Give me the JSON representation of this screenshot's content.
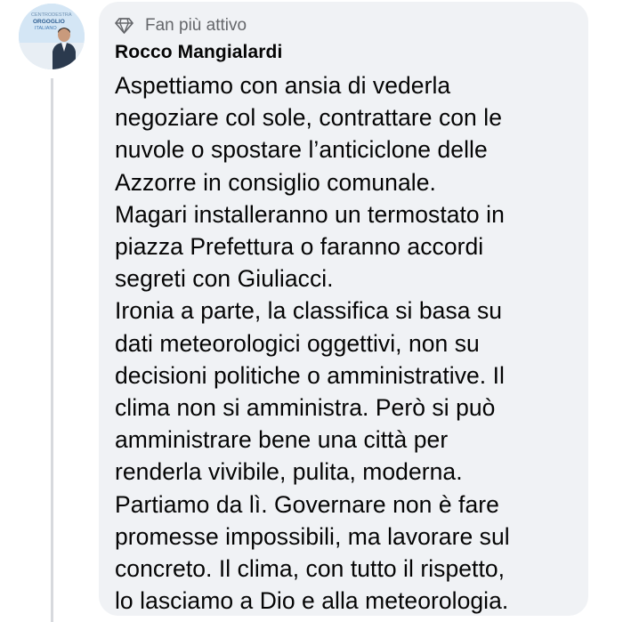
{
  "comment": {
    "badge_icon": "diamond-icon",
    "badge_label": "Fan più attivo",
    "author_name": "Rocco Mangialardi",
    "avatar_logo_text": [
      "CENTRODESTRA",
      "ORGOGLIO",
      "ITALIANO"
    ],
    "text": "Aspettiamo con ansia di vederla\nnegoziare col sole, contrattare con le\nnuvole o spostare l’anticiclone delle\nAzzorre in consiglio comunale.\nMagari installeranno un termostato in\npiazza Prefettura o faranno accordi\nsegreti con Giuliacci.\nIronia a parte, la classifica si basa su\ndati meteorologici oggettivi, non su\ndecisioni politiche o amministrative. Il\nclima non si amministra. Però si può\namministrare bene una città per\nrenderla vivibile, pulita, moderna.\nPartiamo da lì. Governare non è fare\npromesse impossibili, ma lavorare sul\nconcreto. Il clima, con tutto il rispetto,\nlo lasciamo a Dio e alla meteorologia."
  },
  "colors": {
    "bubble_background": "#f0f2f5",
    "badge_text": "#65676b",
    "body_text": "#050505",
    "thread_line": "#d7d9dd"
  }
}
